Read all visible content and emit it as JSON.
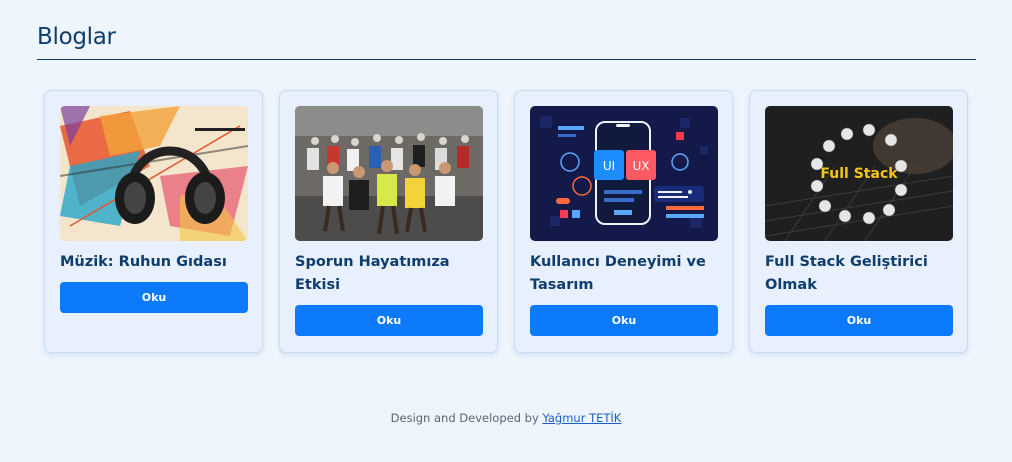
{
  "header": {
    "title": "Bloglar"
  },
  "cards": [
    {
      "title": "Müzik: Ruhun Gıdası",
      "button": "Oku",
      "image_icon": "headphones-art-image"
    },
    {
      "title": "Sporun Hayatımıza Etkisi",
      "button": "Oku",
      "image_icon": "marathon-runners-image"
    },
    {
      "title": "Kullanıcı Deneyimi ve Tasarım",
      "button": "Oku",
      "image_icon": "ui-ux-phone-image",
      "image_text": [
        "UI",
        "UX"
      ]
    },
    {
      "title": "Full Stack Geliştirici Olmak",
      "button": "Oku",
      "image_icon": "full-stack-keyboard-image",
      "image_text": "Full Stack"
    }
  ],
  "footer": {
    "text": "Design and Developed by",
    "author": "Yağmur TETİK"
  },
  "colors": {
    "background": "#eef5fd",
    "card": "#e7f0fc",
    "accent": "#0d79fb",
    "title": "#0f3d6e"
  }
}
